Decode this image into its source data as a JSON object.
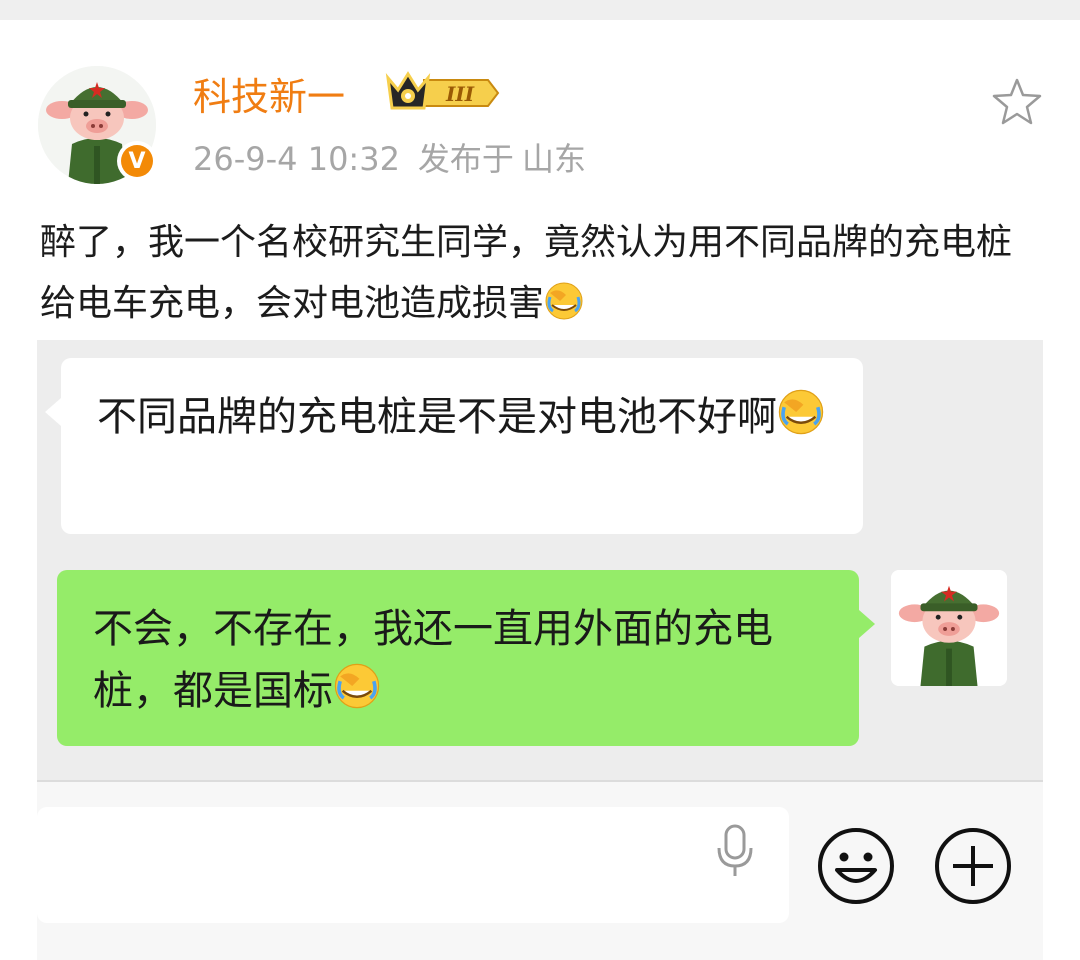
{
  "post": {
    "username": "科技新一",
    "badge_level": "III",
    "time": "26-9-4 10:32",
    "location_prefix": "发布于",
    "location": "山东",
    "text": "醉了，我一个名校研究生同学，竟然认为用不同品牌的充电桩给电车充电，会对电池造成损害",
    "verified_mark": "V"
  },
  "chat": {
    "received_message": "不同品牌的充电桩是不是对电池不好啊",
    "sent_message": "不会，不存在，我还一直用外面的充电桩，都是国标"
  },
  "icons": {
    "favorite": "star-outline-icon",
    "voice": "microphone-icon",
    "emoji": "smiley-icon",
    "more": "plus-circle-icon",
    "inline_emoji": "facepalm-laugh-emoji"
  },
  "colors": {
    "username": "#f07d12",
    "sent_bubble": "#95ec69",
    "received_bubble": "#ffffff",
    "chat_background": "#ededed",
    "verified": "#f38a07"
  }
}
